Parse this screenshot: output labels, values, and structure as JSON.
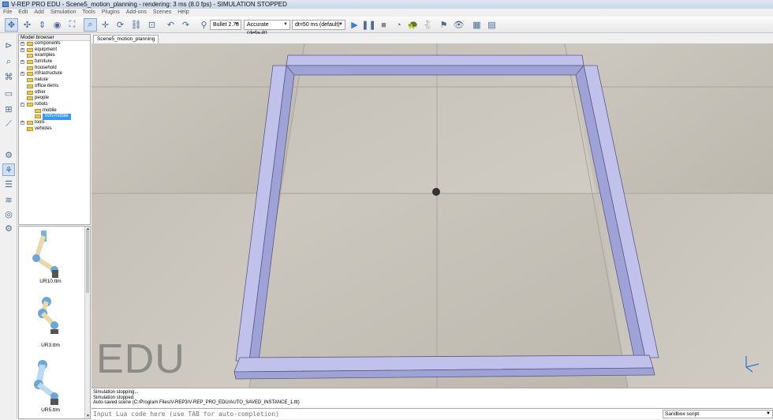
{
  "window": {
    "title": "V-REP PRO EDU - Scene5_motion_planning - rendering: 3 ms (8.0 fps) - SIMULATION STOPPED"
  },
  "menu": [
    "File",
    "Edit",
    "Add",
    "Simulation",
    "Tools",
    "Plugins",
    "Add-ons",
    "Scenes",
    "Help"
  ],
  "toolbar": {
    "engine": "Bullet 2.78",
    "accuracy": "Accurate (default)",
    "dt": "dt=50 ms (default)"
  },
  "model_browser": {
    "title": "Model browser",
    "items": [
      {
        "label": "components",
        "level": 0,
        "expand": "+"
      },
      {
        "label": "equipment",
        "level": 0,
        "expand": "+"
      },
      {
        "label": "examples",
        "level": 0,
        "expand": ""
      },
      {
        "label": "furniture",
        "level": 0,
        "expand": "+"
      },
      {
        "label": "household",
        "level": 0,
        "expand": ""
      },
      {
        "label": "infrastructure",
        "level": 0,
        "expand": "+"
      },
      {
        "label": "nature",
        "level": 0,
        "expand": ""
      },
      {
        "label": "office items",
        "level": 0,
        "expand": ""
      },
      {
        "label": "other",
        "level": 0,
        "expand": ""
      },
      {
        "label": "people",
        "level": 0,
        "expand": ""
      },
      {
        "label": "robots",
        "level": 0,
        "expand": "-"
      },
      {
        "label": "mobile",
        "level": 1,
        "expand": ""
      },
      {
        "label": "non-mobile",
        "level": 1,
        "expand": "",
        "selected": true
      },
      {
        "label": "tools",
        "level": 0,
        "expand": "+"
      },
      {
        "label": "vehicles",
        "level": 0,
        "expand": ""
      }
    ]
  },
  "thumbnails": [
    "UR10.ttm",
    "UR3.ttm",
    "UR5.ttm"
  ],
  "scene_tab": "Scene5_motion_planning",
  "viewport": {
    "watermark": "EDU"
  },
  "console": {
    "lines": [
      "Simulation stopping...",
      "Simulation stopped.",
      "Auto-saved scene (C:/Program Files/V-REP3/V-REP_PRO_EDU/AUTO_SAVED_INSTANCE_1.ttt)"
    ]
  },
  "lua_input": {
    "placeholder": "Input Lua code here (use TAB for auto-completion)"
  },
  "script_select": "Sandbox script",
  "icons": {
    "toolbar": [
      "camera-pan-icon",
      "camera-rotate-icon",
      "camera-shift-icon",
      "camera-zoom-icon",
      "camera-fit-icon",
      "camera-angle-icon",
      "select-icon",
      "object-shift-icon",
      "object-rotate-icon",
      "assemble-icon",
      "undo-icon",
      "redo-icon",
      "dynamics-icon",
      "play-icon",
      "pause-icon",
      "stop-icon",
      "realtime-icon",
      "slower-icon",
      "faster-icon",
      "thread-icon",
      "visualization-icon",
      "page-icon",
      "page-selector-icon"
    ],
    "left": [
      "scene-hierarchy-icon",
      "model-browser-icon",
      "object-properties-icon",
      "calculation-module-icon",
      "collections-icon",
      "scripts-icon",
      "shape-edit-icon",
      "path-edit-icon",
      "selection-icon",
      "layers-icon",
      "video-icon",
      "user-settings-icon"
    ]
  }
}
